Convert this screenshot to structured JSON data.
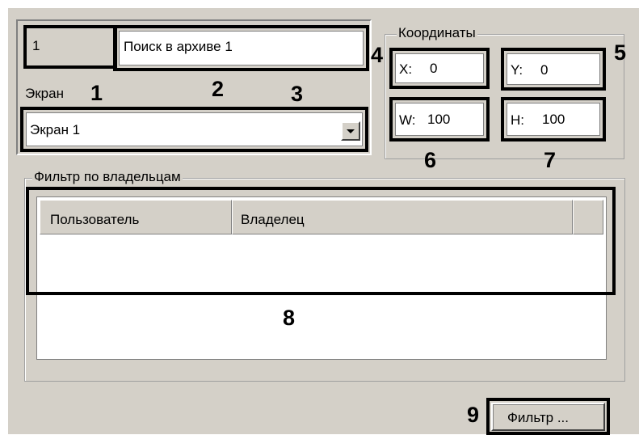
{
  "object": {
    "id": "1",
    "name": "Поиск в архиве 1",
    "screen_label": "Экран",
    "screen_value": "Экран 1"
  },
  "coordinates": {
    "title": "Координаты",
    "x_label": "X:",
    "x_value": "0",
    "y_label": "Y:",
    "y_value": "0",
    "w_label": "W:",
    "w_value": "100",
    "h_label": "H:",
    "h_value": "100"
  },
  "owner_filter": {
    "title": "Фильтр по владельцам",
    "columns": [
      "Пользователь",
      "Владелец"
    ]
  },
  "filter_button": "Фильтр ...",
  "callouts": {
    "n1": "1",
    "n2": "2",
    "n3": "3",
    "n4": "4",
    "n5": "5",
    "n6": "6",
    "n7": "7",
    "n8": "8",
    "n9": "9"
  },
  "icons": {
    "dropdown": "chevron-down-icon"
  }
}
